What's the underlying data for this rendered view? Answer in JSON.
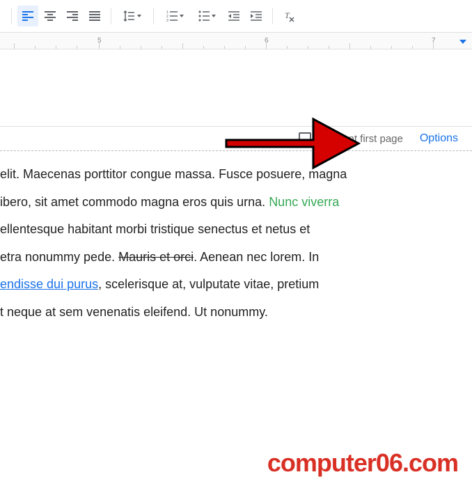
{
  "toolbar": {
    "align_left": "align-left",
    "align_center": "align-center",
    "align_right": "align-right",
    "align_justify": "align-justify",
    "line_spacing": "line-spacing",
    "numbered_list": "numbered-list",
    "bulleted_list": "bulleted-list",
    "decrease_indent": "decrease-indent",
    "increase_indent": "increase-indent",
    "clear_formatting": "clear-formatting"
  },
  "ruler": {
    "marks": [
      "5",
      "6",
      "7"
    ]
  },
  "header": {
    "checkbox_label": "Different first page",
    "options_label": "Options"
  },
  "body": {
    "line1_a": "elit. Maecenas porttitor congue massa. Fusce posuere, magna",
    "line2_a": "ibero, sit amet commodo magna eros quis urna. ",
    "line2_green": "Nunc viverra",
    "line3": "ellentesque habitant morbi tristique senectus et netus et",
    "line4_a": "etra nonummy pede. ",
    "line4_strike": "Mauris et orci",
    "line4_b": ". Aenean nec lorem. In",
    "line5_link": "endisse dui purus",
    "line5_b": ", scelerisque at, vulputate vitae, pretium",
    "line6": "t neque at sem venenatis eleifend. Ut nonummy."
  },
  "watermark": "computer06.com"
}
